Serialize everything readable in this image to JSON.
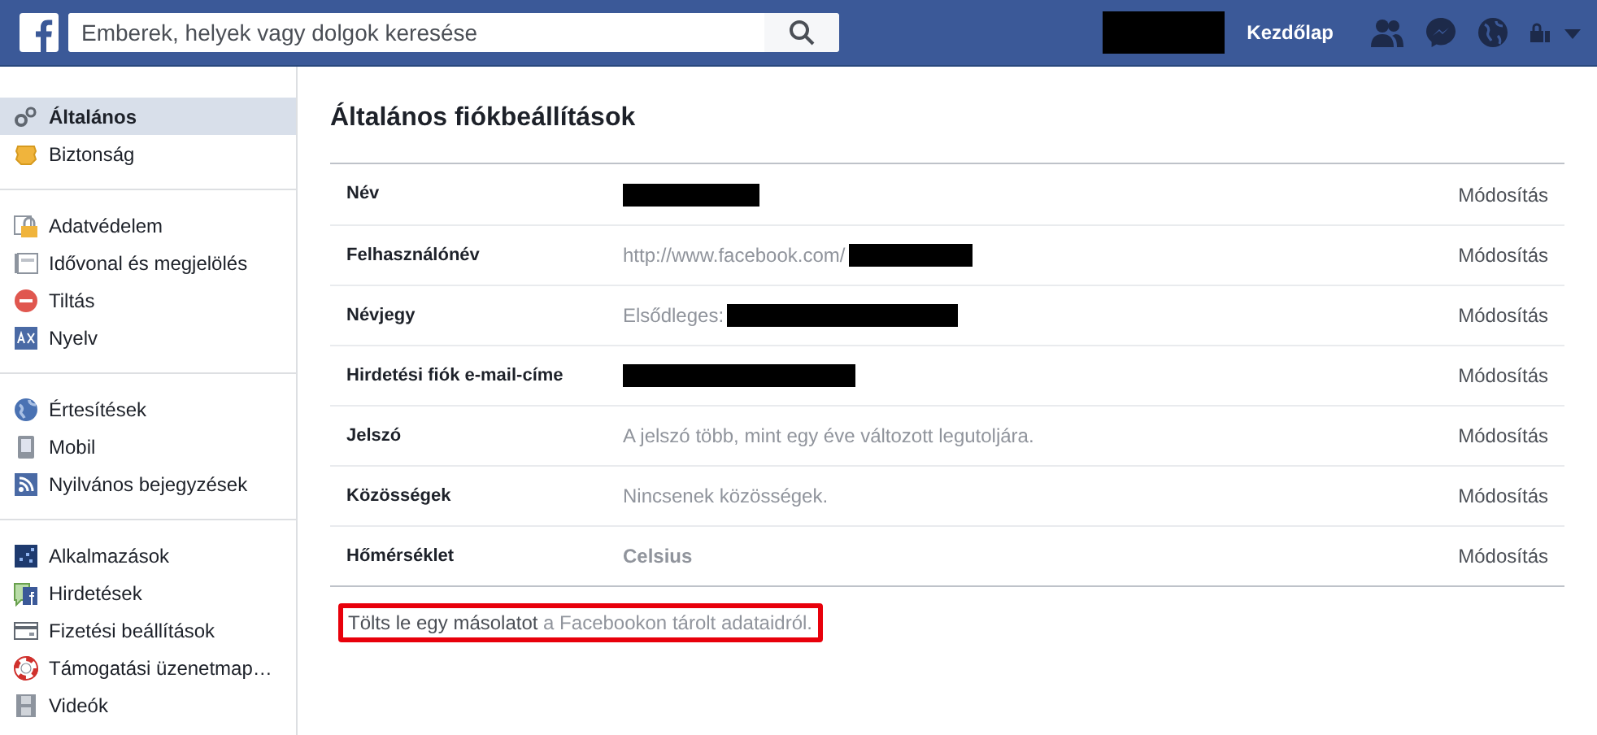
{
  "topbar": {
    "search": {
      "placeholder": "Emberek, helyek vagy dolgok keresése"
    },
    "profile_redacted": true,
    "home_link": "Kezdőlap"
  },
  "sidebar": {
    "groups": [
      {
        "items": [
          {
            "label": "Általános",
            "selected": true
          },
          {
            "label": "Biztonság",
            "selected": false
          }
        ]
      },
      {
        "items": [
          {
            "label": "Adatvédelem",
            "selected": false
          },
          {
            "label": "Idővonal és megjelölés",
            "selected": false
          },
          {
            "label": "Tiltás",
            "selected": false
          },
          {
            "label": "Nyelv",
            "selected": false
          }
        ]
      },
      {
        "items": [
          {
            "label": "Értesítések",
            "selected": false
          },
          {
            "label": "Mobil",
            "selected": false
          },
          {
            "label": "Nyilvános bejegyzések",
            "selected": false
          }
        ]
      },
      {
        "items": [
          {
            "label": "Alkalmazások",
            "selected": false
          },
          {
            "label": "Hirdetések",
            "selected": false
          },
          {
            "label": "Fizetési beállítások",
            "selected": false
          },
          {
            "label": "Támogatási üzenetmap…",
            "selected": false
          },
          {
            "label": "Videók",
            "selected": false
          }
        ]
      }
    ]
  },
  "main": {
    "title": "Általános fiókbeállítások",
    "rows": [
      {
        "label": "Név",
        "redacted": true,
        "action": "Módosítás"
      },
      {
        "label": "Felhasználónév",
        "value": "http://www.facebook.com/",
        "redacted": true,
        "action": "Módosítás"
      },
      {
        "label": "Névjegy",
        "value": "Elsődleges:",
        "redacted": true,
        "action": "Módosítás"
      },
      {
        "label": "Hirdetési fiók e-mail-címe",
        "redacted": true,
        "action": "Módosítás"
      },
      {
        "label": "Jelszó",
        "value": "A jelszó több, mint egy éve változott legutoljára.",
        "redacted": false,
        "action": "Módosítás"
      },
      {
        "label": "Közösségek",
        "value": "Nincsenek közösségek.",
        "redacted": false,
        "action": "Módosítás"
      },
      {
        "label": "Hőmérséklet",
        "value": "Celsius",
        "value_bold": true,
        "redacted": false,
        "action": "Módosítás"
      }
    ],
    "download": {
      "link": "Tölts le egy másolatot",
      "rest": " a Facebookon tárolt adataidról.",
      "highlighted": true
    }
  }
}
